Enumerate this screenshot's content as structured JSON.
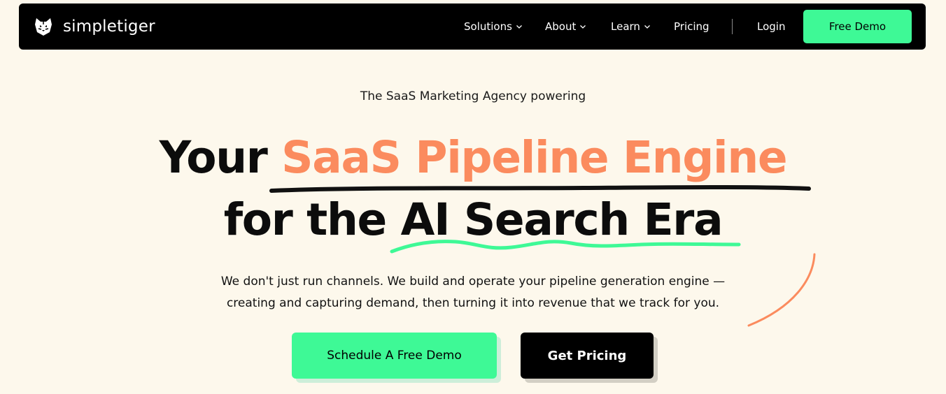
{
  "brand": {
    "name": "simpletiger",
    "logo_icon": "tiger-head-icon"
  },
  "nav": {
    "items": [
      {
        "label": "Solutions",
        "has_dropdown": true
      },
      {
        "label": "About",
        "has_dropdown": true
      },
      {
        "label": "Learn",
        "has_dropdown": true
      },
      {
        "label": "Pricing",
        "has_dropdown": false
      }
    ],
    "login_label": "Login",
    "cta_label": "Free Demo"
  },
  "hero": {
    "eyebrow": "The SaaS Marketing Agency powering",
    "headline_line1_plain": "Your",
    "headline_line1_accent": "SaaS Pipeline Engine",
    "headline_line2_plain": "for the",
    "headline_line2_underlined": "AI Search Era",
    "subtext_line1": "We don't just run channels. We build and operate your pipeline generation engine —",
    "subtext_line2": "creating and capturing demand, then turning it into revenue that we track for you.",
    "primary_cta": "Schedule A Free Demo",
    "secondary_cta": "Get Pricing"
  },
  "colors": {
    "background": "#fdf8ec",
    "accent_orange": "#fb8b5e",
    "accent_green": "#3ef996",
    "nav_background": "#000000"
  }
}
